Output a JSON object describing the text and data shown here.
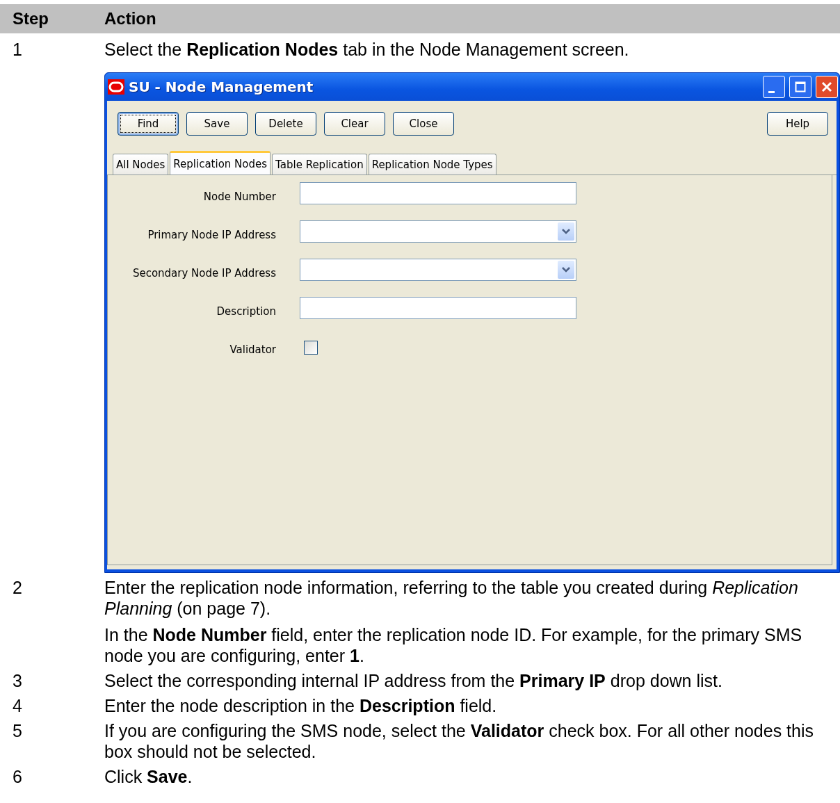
{
  "table": {
    "columns": [
      "Step",
      "Action"
    ],
    "rows": [
      {
        "step": "1",
        "paragraphs": [
          "Select the **Replication Nodes** tab in the Node Management screen."
        ],
        "window": {
          "title": "SU - Node Management",
          "buttons": [
            {
              "label": "Find",
              "focused": true
            },
            {
              "label": "Save",
              "focused": false
            },
            {
              "label": "Delete",
              "focused": false
            },
            {
              "label": "Clear",
              "focused": false
            },
            {
              "label": "Close",
              "focused": false
            }
          ],
          "help_button": "Help",
          "tabs": [
            {
              "label": "All Nodes",
              "selected": false
            },
            {
              "label": "Replication Nodes",
              "selected": true
            },
            {
              "label": "Table Replication",
              "selected": false
            },
            {
              "label": "Replication Node Types",
              "selected": false
            }
          ],
          "fields": [
            {
              "kind": "text",
              "label": "Node Number"
            },
            {
              "kind": "dropdown",
              "label": "Primary Node IP Address"
            },
            {
              "kind": "dropdown",
              "label": "Secondary Node IP Address"
            },
            {
              "kind": "text",
              "label": "Description"
            },
            {
              "kind": "checkbox",
              "label": "Validator",
              "checked": false
            }
          ]
        }
      },
      {
        "step": "2",
        "paragraphs": [
          "Enter the replication node information, referring to the table you created during *Replication Planning* (on page 7).",
          "In the **Node Number** field, enter the replication node ID. For example, for the primary SMS node you are configuring, enter **1**."
        ]
      },
      {
        "step": "3",
        "paragraphs": [
          "Select the corresponding internal IP address from the **Primary IP** drop down list."
        ]
      },
      {
        "step": "4",
        "paragraphs": [
          "Enter the node description in the **Description** field."
        ]
      },
      {
        "step": "5",
        "paragraphs": [
          "If you are configuring the SMS node, select the **Validator** check box. For all other nodes this box should not be selected."
        ]
      },
      {
        "step": "6",
        "paragraphs": [
          "Click **Save**."
        ]
      }
    ]
  }
}
